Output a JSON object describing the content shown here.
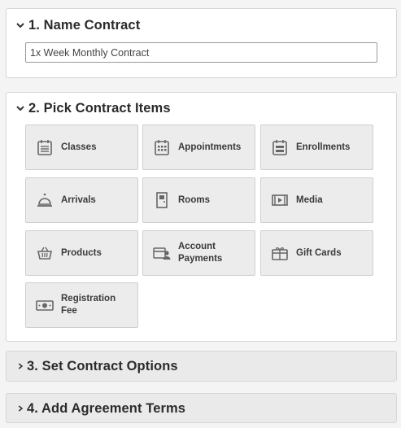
{
  "sections": {
    "name": {
      "title": "1. Name Contract",
      "input_value": "1x Week Monthly Contract"
    },
    "items": {
      "title": "2. Pick Contract Items",
      "tiles": {
        "classes": "Classes",
        "appointments": "Appointments",
        "enrollments": "Enrollments",
        "arrivals": "Arrivals",
        "rooms": "Rooms",
        "media": "Media",
        "products": "Products",
        "account_payments": "Account\nPayments",
        "gift_cards": "Gift Cards",
        "registration_fee": "Registration\nFee"
      }
    },
    "options": {
      "title": "3. Set Contract Options"
    },
    "terms": {
      "title": "4. Add Agreement Terms"
    }
  },
  "icons": {
    "expanded": "chevron-down-icon",
    "collapsed": "chevron-right-icon"
  },
  "colors": {
    "icon": "#666666",
    "tile_bg": "#ececec",
    "panel_collapsed": "#eaeaea"
  }
}
